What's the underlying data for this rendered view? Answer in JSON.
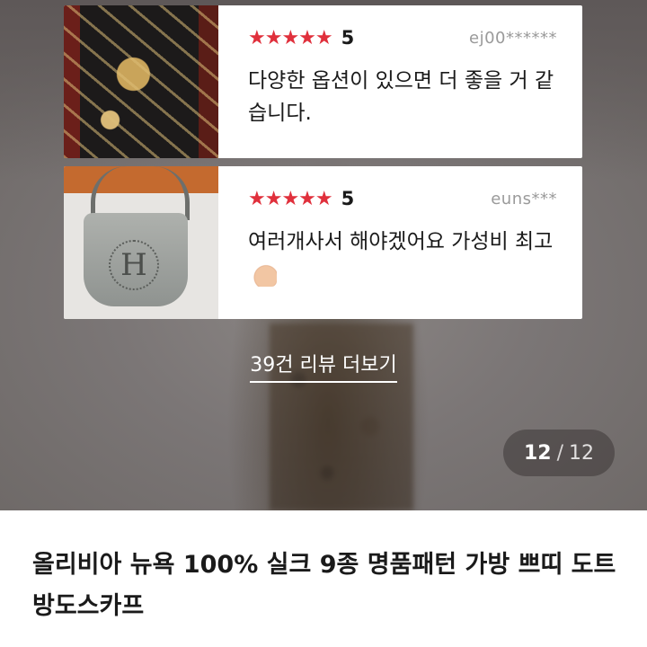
{
  "reviews": [
    {
      "stars": "★★★★★",
      "score": "5",
      "reviewer": "ej00******",
      "text": "다양한 옵션이 있으면 더 좋을 거 같습니다."
    },
    {
      "stars": "★★★★★",
      "score": "5",
      "reviewer": "euns***",
      "text": "여러개사서 해야겠어요 가성비 최고",
      "emoji": "thumbs-up"
    }
  ],
  "more_reviews_label": "39건 리뷰 더보기",
  "page_indicator": {
    "current": "12",
    "separator": "/",
    "total": "12"
  },
  "product_title": "올리비아 뉴욕 100% 실크 9종 명품패턴 가방 쁘띠 도트 방도스카프",
  "colors": {
    "star": "#e0303c",
    "text": "#1a1a1a",
    "reviewer": "#9a9a9a"
  }
}
